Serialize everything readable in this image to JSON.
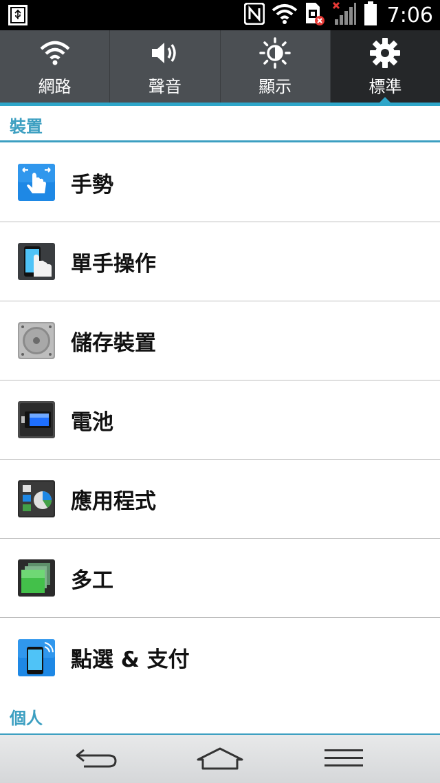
{
  "status_bar": {
    "time": "7:06",
    "icons": [
      "usb-icon",
      "nfc-icon",
      "wifi-icon",
      "sim-error-icon",
      "no-signal-icon",
      "battery-icon"
    ]
  },
  "tabs": [
    {
      "label": "網路",
      "icon": "wifi-icon",
      "active": false
    },
    {
      "label": "聲音",
      "icon": "speaker-icon",
      "active": false
    },
    {
      "label": "顯示",
      "icon": "brightness-icon",
      "active": false
    },
    {
      "label": "標準",
      "icon": "gear-icon",
      "active": true
    }
  ],
  "sections": {
    "device": "裝置",
    "personal": "個人"
  },
  "items": [
    {
      "label": "手勢",
      "icon": "gesture-icon"
    },
    {
      "label": "單手操作",
      "icon": "one-hand-icon"
    },
    {
      "label": "儲存裝置",
      "icon": "storage-icon"
    },
    {
      "label": "電池",
      "icon": "battery-app-icon"
    },
    {
      "label": "應用程式",
      "icon": "apps-icon"
    },
    {
      "label": "多工",
      "icon": "multitask-icon"
    },
    {
      "label": "點選 & 支付",
      "icon": "tap-pay-icon"
    }
  ],
  "navbar": [
    "back-icon",
    "home-icon",
    "menu-icon"
  ],
  "colors": {
    "accent": "#3c9fc1",
    "tab_bg": "#4b4f53",
    "tab_active_bg": "#252729"
  }
}
